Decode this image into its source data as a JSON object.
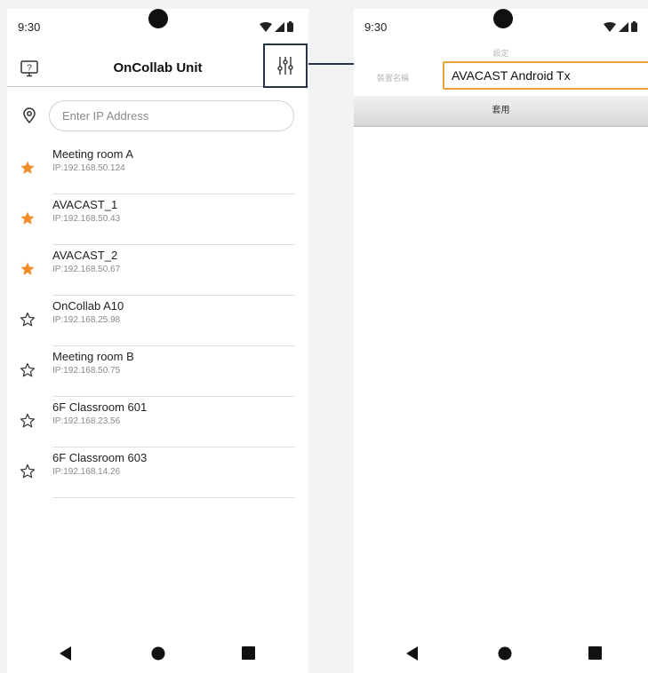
{
  "colors": {
    "accent": "#f0a23a",
    "star_filled": "#f28c28",
    "frame_border": "#25344a"
  },
  "left_screen": {
    "status_time": "9:30",
    "title": "OnCollab Unit",
    "ip_placeholder": "Enter IP Address",
    "devices": [
      {
        "name": "Meeting room A",
        "ip": "IP:192.168.50.124",
        "favorite": true
      },
      {
        "name": "AVACAST_1",
        "ip": "IP:192.168.50.43",
        "favorite": true
      },
      {
        "name": "AVACAST_2",
        "ip": "IP:192.168.50.67",
        "favorite": true
      },
      {
        "name": "OnCollab A10",
        "ip": "IP:192.168.25.98",
        "favorite": false
      },
      {
        "name": "Meeting room B",
        "ip": "IP:192.168.50.75",
        "favorite": false
      },
      {
        "name": "6F Classroom 601",
        "ip": "IP:192.168.23.56",
        "favorite": false
      },
      {
        "name": "6F Classroom 603",
        "ip": "IP:192.168.14.26",
        "favorite": false
      }
    ]
  },
  "right_screen": {
    "status_time": "9:30",
    "title": "設定",
    "device_name_label": "裝置名稱",
    "device_name_value": "AVACAST Android Tx",
    "apply_label": "套用"
  },
  "icons": [
    "help-screen-icon",
    "sliders-icon",
    "location-icon",
    "star-filled-icon",
    "star-outline-icon",
    "wifi-icon",
    "signal-icon",
    "battery-icon",
    "nav-back-icon",
    "nav-home-icon",
    "nav-recent-icon"
  ]
}
